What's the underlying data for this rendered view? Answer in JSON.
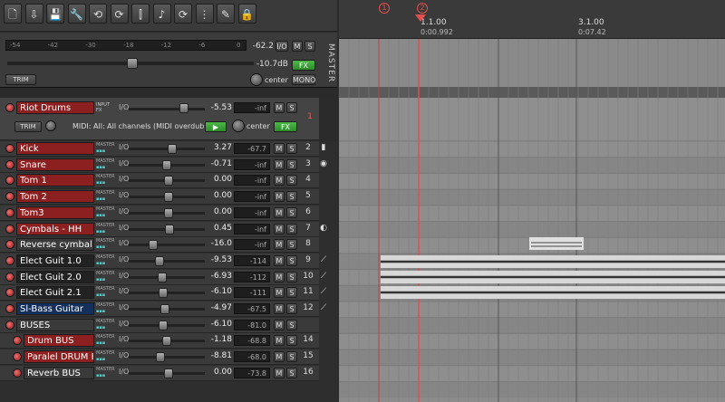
{
  "toolbar": {
    "icons": [
      "new-project-icon",
      "open-project-icon",
      "save-project-icon",
      "settings-icon",
      "ripple-off-icon",
      "ripple-icon",
      "grid-snap-icon",
      "metronome-icon",
      "loop-icon",
      "grid-icon",
      "envelope-icon",
      "lock-icon"
    ]
  },
  "master": {
    "label": "MASTER",
    "meter_ticks": [
      "-54",
      "-42",
      "-30",
      "-18",
      "-12",
      "-6",
      "0"
    ],
    "peak": "-62.2",
    "volume": "-10.7dB",
    "pan": "center",
    "io_label": "I/O",
    "m": "M",
    "s": "S",
    "fx": "FX",
    "trim": "TRIM",
    "mono": "MONO"
  },
  "selected_track": {
    "name": "Riot Drums",
    "tag_top": "INPUT",
    "tag_bottom": "FX",
    "io": "I/O",
    "volume": "-5.53",
    "peak": "-inf",
    "number": "1",
    "midi_input": "MIDI: All: All channels (MIDI overdub)",
    "pan": "center",
    "trim": "TRIM",
    "fx": "FX",
    "m": "M",
    "s": "S"
  },
  "tracks": [
    {
      "name": "Kick",
      "volume": "3.27",
      "peak": "-67.7",
      "number": "2",
      "tag": "MASTER",
      "color": "#8c1f1f",
      "fader": 0.6
    },
    {
      "name": "Snare",
      "volume": "-0.71",
      "peak": "-inf",
      "number": "3",
      "tag": "MASTER",
      "color": "#8c1f1f",
      "fader": 0.52
    },
    {
      "name": "Tom 1",
      "volume": "0.00",
      "peak": "-inf",
      "number": "4",
      "tag": "MASTER",
      "color": "#8c1f1f",
      "fader": 0.54
    },
    {
      "name": "Tom 2",
      "volume": "0.00",
      "peak": "-inf",
      "number": "5",
      "tag": "MASTER",
      "color": "#8c1f1f",
      "fader": 0.54
    },
    {
      "name": "Tom3",
      "volume": "0.00",
      "peak": "-inf",
      "number": "6",
      "tag": "MASTER",
      "color": "#8c1f1f",
      "fader": 0.54
    },
    {
      "name": "Cymbals - HH",
      "volume": "0.45",
      "peak": "-inf",
      "number": "7",
      "tag": "MASTER",
      "color": "#8c1f1f",
      "fader": 0.56
    },
    {
      "name": "Reverse cymbal",
      "volume": "-16.0",
      "peak": "-inf",
      "number": "8",
      "tag": "MASTER",
      "color": "#3a3a3a",
      "fader": 0.3
    },
    {
      "name": "Elect Guit 1.0",
      "volume": "-9.53",
      "peak": "-114",
      "number": "9",
      "tag": "MASTER",
      "color": "#222222",
      "fader": 0.4
    },
    {
      "name": "Elect Guit 2.0",
      "volume": "-6.93",
      "peak": "-112",
      "number": "10",
      "tag": "MASTER",
      "color": "#222222",
      "fader": 0.45
    },
    {
      "name": "Elect Guit 2.1",
      "volume": "-6.10",
      "peak": "-111",
      "number": "11",
      "tag": "MASTER",
      "color": "#222222",
      "fader": 0.46
    },
    {
      "name": "Sl-Bass Guitar",
      "volume": "-4.97",
      "peak": "-67.5",
      "number": "12",
      "tag": "MASTER",
      "color": "#14305a",
      "fader": 0.48
    },
    {
      "name": "BUSES",
      "volume": "-6.10",
      "peak": "-81.0",
      "number": "",
      "tag": "MASTER",
      "color": "#3a3a3a",
      "fader": 0.46
    },
    {
      "name": "Drum BUS",
      "volume": "-1.18",
      "peak": "-68.8",
      "number": "14",
      "tag": "MASTER",
      "color": "#8c1f1f",
      "fader": 0.52,
      "indent": true
    },
    {
      "name": "Paralel DRUM B",
      "volume": "-8.81",
      "peak": "-68.0",
      "number": "15",
      "tag": "MASTER",
      "color": "#8c1f1f",
      "fader": 0.42,
      "indent": true
    },
    {
      "name": "Reverb BUS",
      "volume": "0.00",
      "peak": "-73.8",
      "number": "16",
      "tag": "MASTER",
      "color": "#3a3a3a",
      "fader": 0.54,
      "indent": true
    }
  ],
  "track_io": "I/O",
  "track_m": "M",
  "track_s": "S",
  "ruler": {
    "markers": [
      "1",
      "2"
    ],
    "bar1_label": "1.1.00",
    "bar1_time": "0:00.992",
    "bar2_label": "3.1.00",
    "bar2_time": "0:07.42"
  },
  "colors": {
    "accent": "#e05050",
    "track_red": "#8c1f1f",
    "fx_green": "#3a9a36"
  }
}
